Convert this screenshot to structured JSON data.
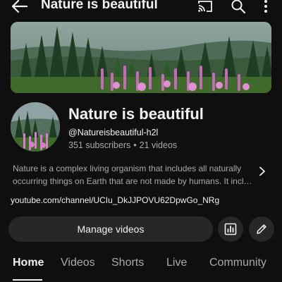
{
  "topbar": {
    "title": "Nature is beautiful",
    "icons": [
      "back-arrow-icon",
      "cast-icon",
      "search-icon",
      "more-vert-icon"
    ]
  },
  "channel": {
    "name": "Nature is beautiful",
    "handle": "@Natureisbeautiful-h2l",
    "subscribers": "351 subscribers",
    "separator": "•",
    "videos": "21 videos",
    "description_line1": "Nature is a complex living organism that includes all naturally",
    "description_line2": "occurring things on Earth that are not made by humans. It inclu...",
    "link": "youtube.com/channel/UCIu_DkJJPOVU62DpwGo_NRg"
  },
  "actions": {
    "manage_label": "Manage videos",
    "icons": [
      "analytics-icon",
      "edit-icon"
    ]
  },
  "tabs": [
    {
      "label": "Home",
      "active": true
    },
    {
      "label": "Videos",
      "active": false
    },
    {
      "label": "Shorts",
      "active": false
    },
    {
      "label": "Live",
      "active": false
    },
    {
      "label": "Community",
      "active": false
    }
  ],
  "colors": {
    "background": "#0f0f0f",
    "text_primary": "#f1f1f1",
    "text_secondary": "#aaaaaa",
    "button_bg": "#272727"
  }
}
